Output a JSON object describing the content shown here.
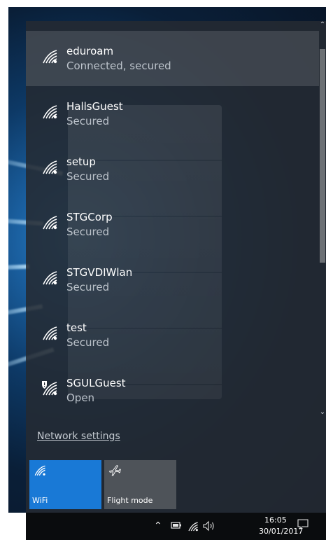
{
  "networks": [
    {
      "name": "eduroam",
      "status": "Connected, secured",
      "connected": true,
      "icon": "wifi-icon"
    },
    {
      "name": "HallsGuest",
      "status": "Secured",
      "connected": false,
      "icon": "wifi-icon"
    },
    {
      "name": "setup",
      "status": "Secured",
      "connected": false,
      "icon": "wifi-icon"
    },
    {
      "name": "STGCorp",
      "status": "Secured",
      "connected": false,
      "icon": "wifi-icon"
    },
    {
      "name": "STGVDIWlan",
      "status": "Secured",
      "connected": false,
      "icon": "wifi-icon"
    },
    {
      "name": "test",
      "status": "Secured",
      "connected": false,
      "icon": "wifi-icon"
    },
    {
      "name": "SGULGuest",
      "status": "Open",
      "connected": false,
      "icon": "wifi-shield-icon"
    }
  ],
  "footer": {
    "network_settings_label": "Network settings"
  },
  "quick_actions": {
    "wifi_label": "WiFi",
    "flight_mode_label": "Flight mode"
  },
  "taskbar": {
    "time": "16:05",
    "date": "30/01/2017"
  },
  "colors": {
    "accent": "#1979d6",
    "flyout_bg": "#242a32",
    "tile_inactive": "#4e5359"
  }
}
